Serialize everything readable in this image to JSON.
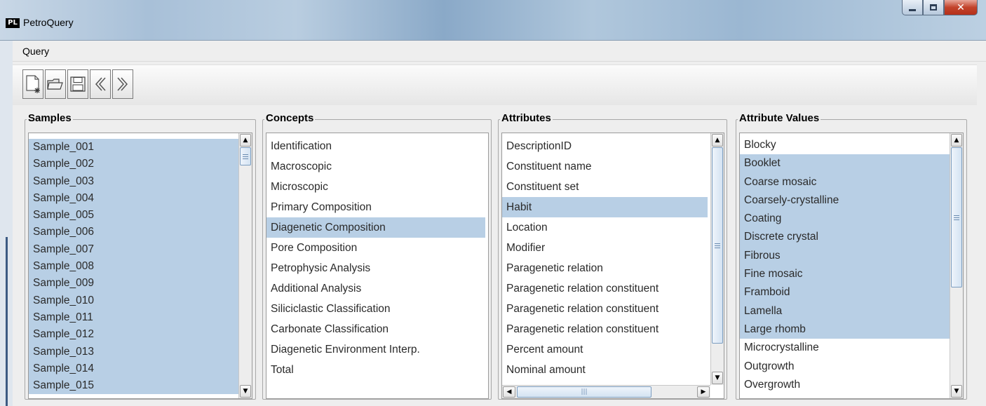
{
  "window": {
    "title": "PetroQuery",
    "logo_text": "PL"
  },
  "menu": {
    "query_label": "Query"
  },
  "toolbar": {
    "buttons": [
      {
        "icon": "new-document-icon"
      },
      {
        "icon": "open-folder-icon"
      },
      {
        "icon": "save-icon"
      },
      {
        "icon": "back-icon"
      },
      {
        "icon": "forward-icon"
      }
    ]
  },
  "samples": {
    "title": "Samples",
    "items": [
      "Sample_001",
      "Sample_002",
      "Sample_003",
      "Sample_004",
      "Sample_005",
      "Sample_006",
      "Sample_007",
      "Sample_008",
      "Sample_009",
      "Sample_010",
      "Sample_011",
      "Sample_012",
      "Sample_013",
      "Sample_014",
      "Sample_015"
    ]
  },
  "concepts": {
    "title": "Concepts",
    "items": [
      "Identification",
      "Macroscopic",
      "Microscopic",
      "Primary Composition",
      "Diagenetic Composition",
      "Pore Composition",
      "Petrophysic Analysis",
      "Additional Analysis",
      "Siliciclastic Classification",
      "Carbonate Classification",
      "Diagenetic Environment Interp.",
      "Total"
    ],
    "selected": "Diagenetic Composition"
  },
  "attributes": {
    "title": "Attributes",
    "items": [
      "DescriptionID",
      "Constituent name",
      "Constituent set",
      "Habit",
      "Location",
      "Modifier",
      "Paragenetic relation",
      "Paragenetic relation constituent",
      "Paragenetic relation constituent",
      "Paragenetic relation constituent",
      "Percent amount",
      "Nominal amount"
    ],
    "selected": "Habit"
  },
  "values": {
    "title": "Attribute Values",
    "items": [
      "Blocky",
      "Booklet",
      "Coarse mosaic",
      "Coarsely-crystalline",
      "Coating",
      "Discrete crystal",
      "Fibrous",
      "Fine mosaic",
      "Framboid",
      "Lamella",
      "Large rhomb",
      "Microcrystalline",
      "Outgrowth",
      "Overgrowth"
    ],
    "selected": [
      "Booklet",
      "Coarse mosaic",
      "Coarsely-crystalline",
      "Coating",
      "Discrete crystal",
      "Fibrous",
      "Fine mosaic",
      "Framboid",
      "Lamella",
      "Large rhomb"
    ]
  },
  "colors": {
    "selection": "#b8cfe5",
    "background": "#eeeeee"
  }
}
